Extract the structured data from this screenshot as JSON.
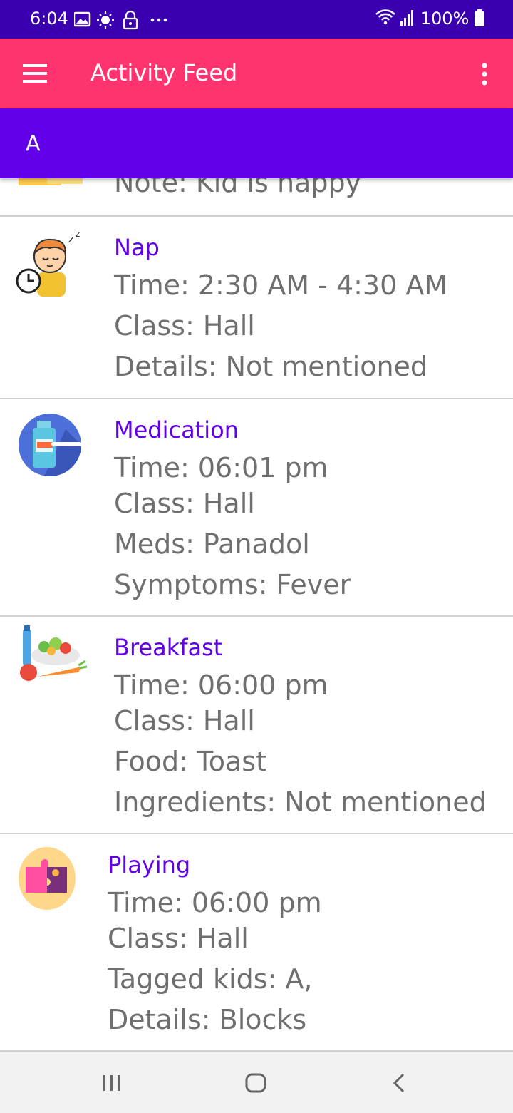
{
  "status_bar": {
    "time": "6:04",
    "battery": "100%",
    "icons": [
      "image-icon",
      "brightness-icon",
      "lock-icon",
      "more-dots-icon",
      "wifi-icon",
      "signal-icon",
      "battery-icon"
    ]
  },
  "app_bar": {
    "title": "Activity Feed",
    "menu_icon": "hamburger-menu-icon",
    "more_icon": "more-vertical-icon",
    "color": "#ff336e"
  },
  "child_bar": {
    "name": "A",
    "color": "#6200ea"
  },
  "feed": {
    "partial_note": "Note: Kid is happy",
    "cards": [
      {
        "title": "Nap",
        "icon": "sleeping-child-icon",
        "lines": [
          "Time: 2:30 AM - 4:30 AM",
          "Class: Hall",
          "Details: Not mentioned"
        ]
      },
      {
        "title": "Medication",
        "icon": "medicine-bottle-icon",
        "lines": [
          "Time: 06:01 pm",
          "Class: Hall",
          "Meds: Panadol",
          "Symptoms: Fever"
        ]
      },
      {
        "title": "Breakfast",
        "icon": "food-salad-icon",
        "lines": [
          "Time: 06:00 pm",
          "Class: Hall",
          "Food: Toast",
          "Ingredients: Not mentioned"
        ]
      },
      {
        "title": "Playing",
        "icon": "puzzle-piece-icon",
        "lines": [
          "Time: 06:00 pm",
          "Class: Hall",
          "Tagged kids: A,",
          "Details: Blocks"
        ]
      }
    ]
  },
  "nav_bar": {
    "icons": [
      "recent-apps-icon",
      "home-icon",
      "back-icon"
    ]
  }
}
